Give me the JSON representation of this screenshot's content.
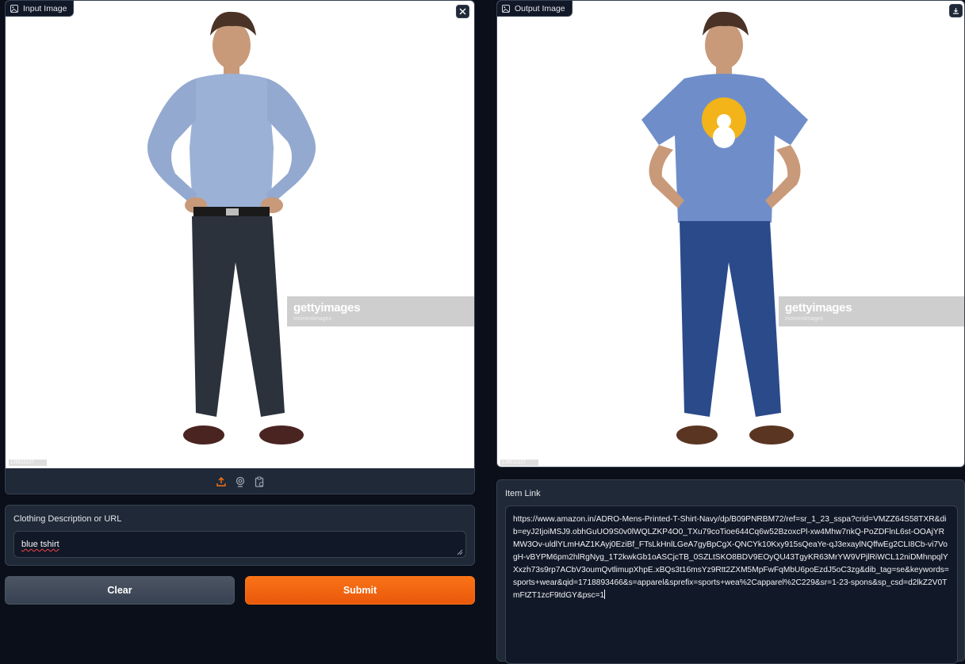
{
  "input_panel": {
    "label": "Input Image",
    "icon": "image-icon",
    "clear_icon": "close-icon",
    "watermark_brand": "gettyimages",
    "watermark_sub": "momentimages",
    "photo_id": "129512127",
    "toolbar_icons": [
      "upload-icon",
      "webcam-icon",
      "clipboard-icon"
    ]
  },
  "description": {
    "label": "Clothing Description or URL",
    "value": "blue tshirt"
  },
  "buttons": {
    "clear": "Clear",
    "submit": "Submit"
  },
  "output_panel": {
    "label": "Output Image",
    "icon": "image-icon",
    "download_icon": "download-icon",
    "watermark_brand": "gettyimages",
    "watermark_sub": "momentimages",
    "photo_id": "129512127"
  },
  "item_link": {
    "label": "Item Link",
    "value": "https://www.amazon.in/ADRO-Mens-Printed-T-Shirt-Navy/dp/B09PNRBM72/ref=sr_1_23_sspa?crid=VMZZ64S58TXR&dib=eyJ2IjoiMSJ9.obhGuUO9S0v0lWQLZKP4O0_TXu79coTioe644Cq6w52BzoxcPl-xw4Mhw7nkQ-PoZDFlnL6st-OOAjYRMW3Ov-uldlYLmHAZ1KAyj0EziBf_FTsLkHnlLGeA7gyBpCgX-QNCYk10Kxy915sQeaYe-qJ3exaylNQffwEg2CLI8Cb-vi7VogH-vBYPM6pm2hlRgNyg_1T2kwkGb1oASCjcTB_0SZLtSKO8BDV9EOyQU43TgyKR63MrYW9VPjlRiWCL12niDMhnpqlYXxzh73s9rp7ACbV3oumQvtlimupXhpE.xBQs3t16msYz9Rtt2ZXM5MpFwFqMbU6poEzdJ5oC3zg&dib_tag=se&keywords=sports+wear&qid=1718893466&s=apparel&sprefix=sports+wea%2Capparel%2C229&sr=1-23-spons&sp_csd=d2lkZ2V0TmFtZT1zcF9tdGY&psc=1"
  },
  "colors": {
    "background": "#0b0f19",
    "panel": "#1f2937",
    "border": "#374151",
    "accent": "#f97316"
  }
}
